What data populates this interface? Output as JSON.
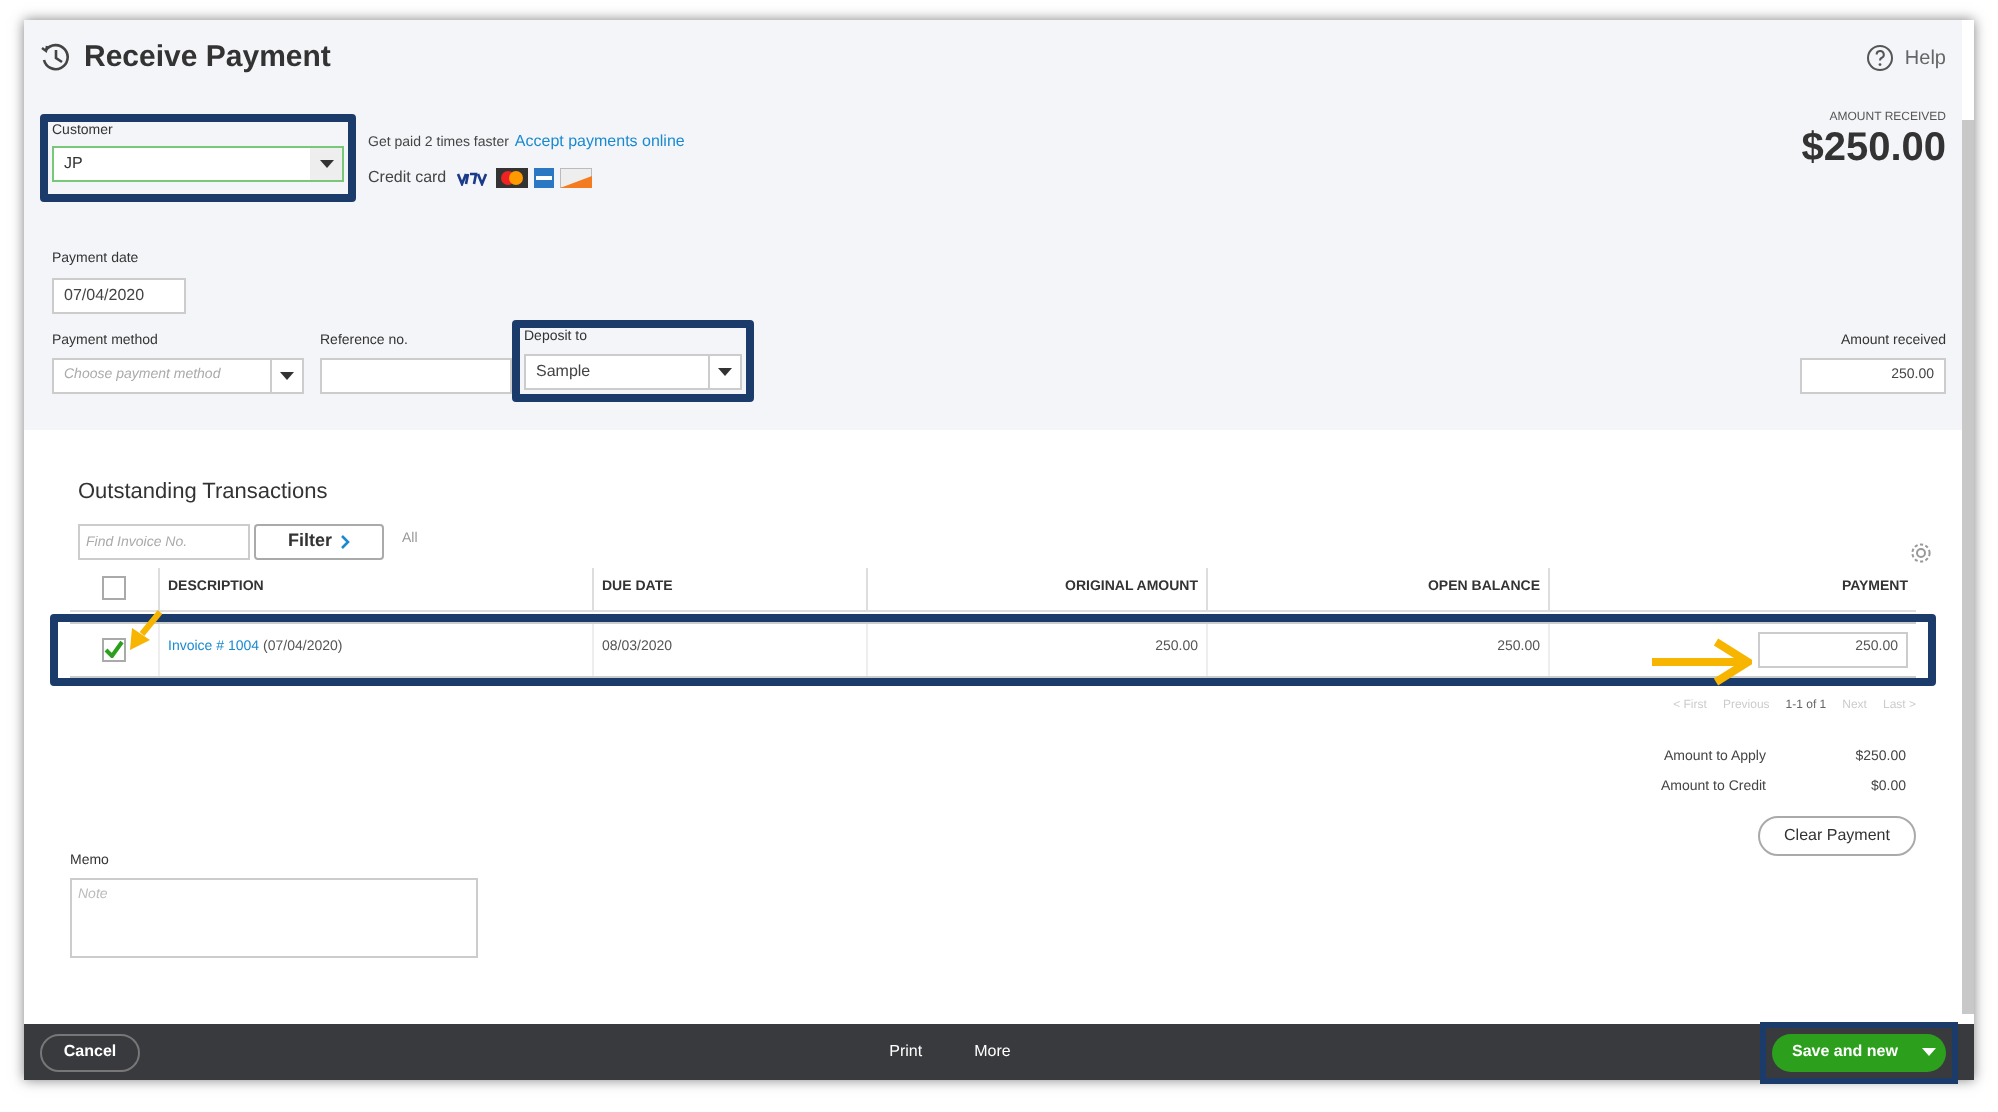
{
  "header": {
    "title": "Receive Payment",
    "help": "Help"
  },
  "customer": {
    "label": "Customer",
    "value": "JP"
  },
  "promo": {
    "text": "Get paid 2 times faster",
    "link": "Accept payments online",
    "credit_label": "Credit card"
  },
  "amount_summary": {
    "label": "AMOUNT RECEIVED",
    "value": "$250.00"
  },
  "payment_date": {
    "label": "Payment date",
    "value": "07/04/2020"
  },
  "payment_method": {
    "label": "Payment method",
    "placeholder": "Choose payment method"
  },
  "reference_no": {
    "label": "Reference no."
  },
  "deposit_to": {
    "label": "Deposit to",
    "value": "Sample"
  },
  "amount_received": {
    "label": "Amount received",
    "value": "250.00"
  },
  "outstanding": {
    "title": "Outstanding Transactions",
    "find_placeholder": "Find Invoice No.",
    "filter": "Filter",
    "all": "All",
    "select_all_checked": false,
    "columns": [
      "DESCRIPTION",
      "DUE DATE",
      "ORIGINAL AMOUNT",
      "OPEN BALANCE",
      "PAYMENT"
    ],
    "rows": [
      {
        "checked": true,
        "invoice": "Invoice # 1004",
        "invoice_date": "(07/04/2020)",
        "due_date": "08/03/2020",
        "original_amount": "250.00",
        "open_balance": "250.00",
        "payment": "250.00"
      }
    ]
  },
  "pagination": {
    "first": "< First",
    "previous": "Previous",
    "range": "1-1 of 1",
    "next": "Next",
    "last": "Last >"
  },
  "totals": [
    {
      "label": "Amount to Apply",
      "value": "$250.00"
    },
    {
      "label": "Amount to Credit",
      "value": "$0.00"
    }
  ],
  "clear_payment": "Clear Payment",
  "memo": {
    "label": "Memo",
    "placeholder": "Note"
  },
  "footer": {
    "cancel": "Cancel",
    "print": "Print",
    "more": "More",
    "save": "Save and new"
  }
}
